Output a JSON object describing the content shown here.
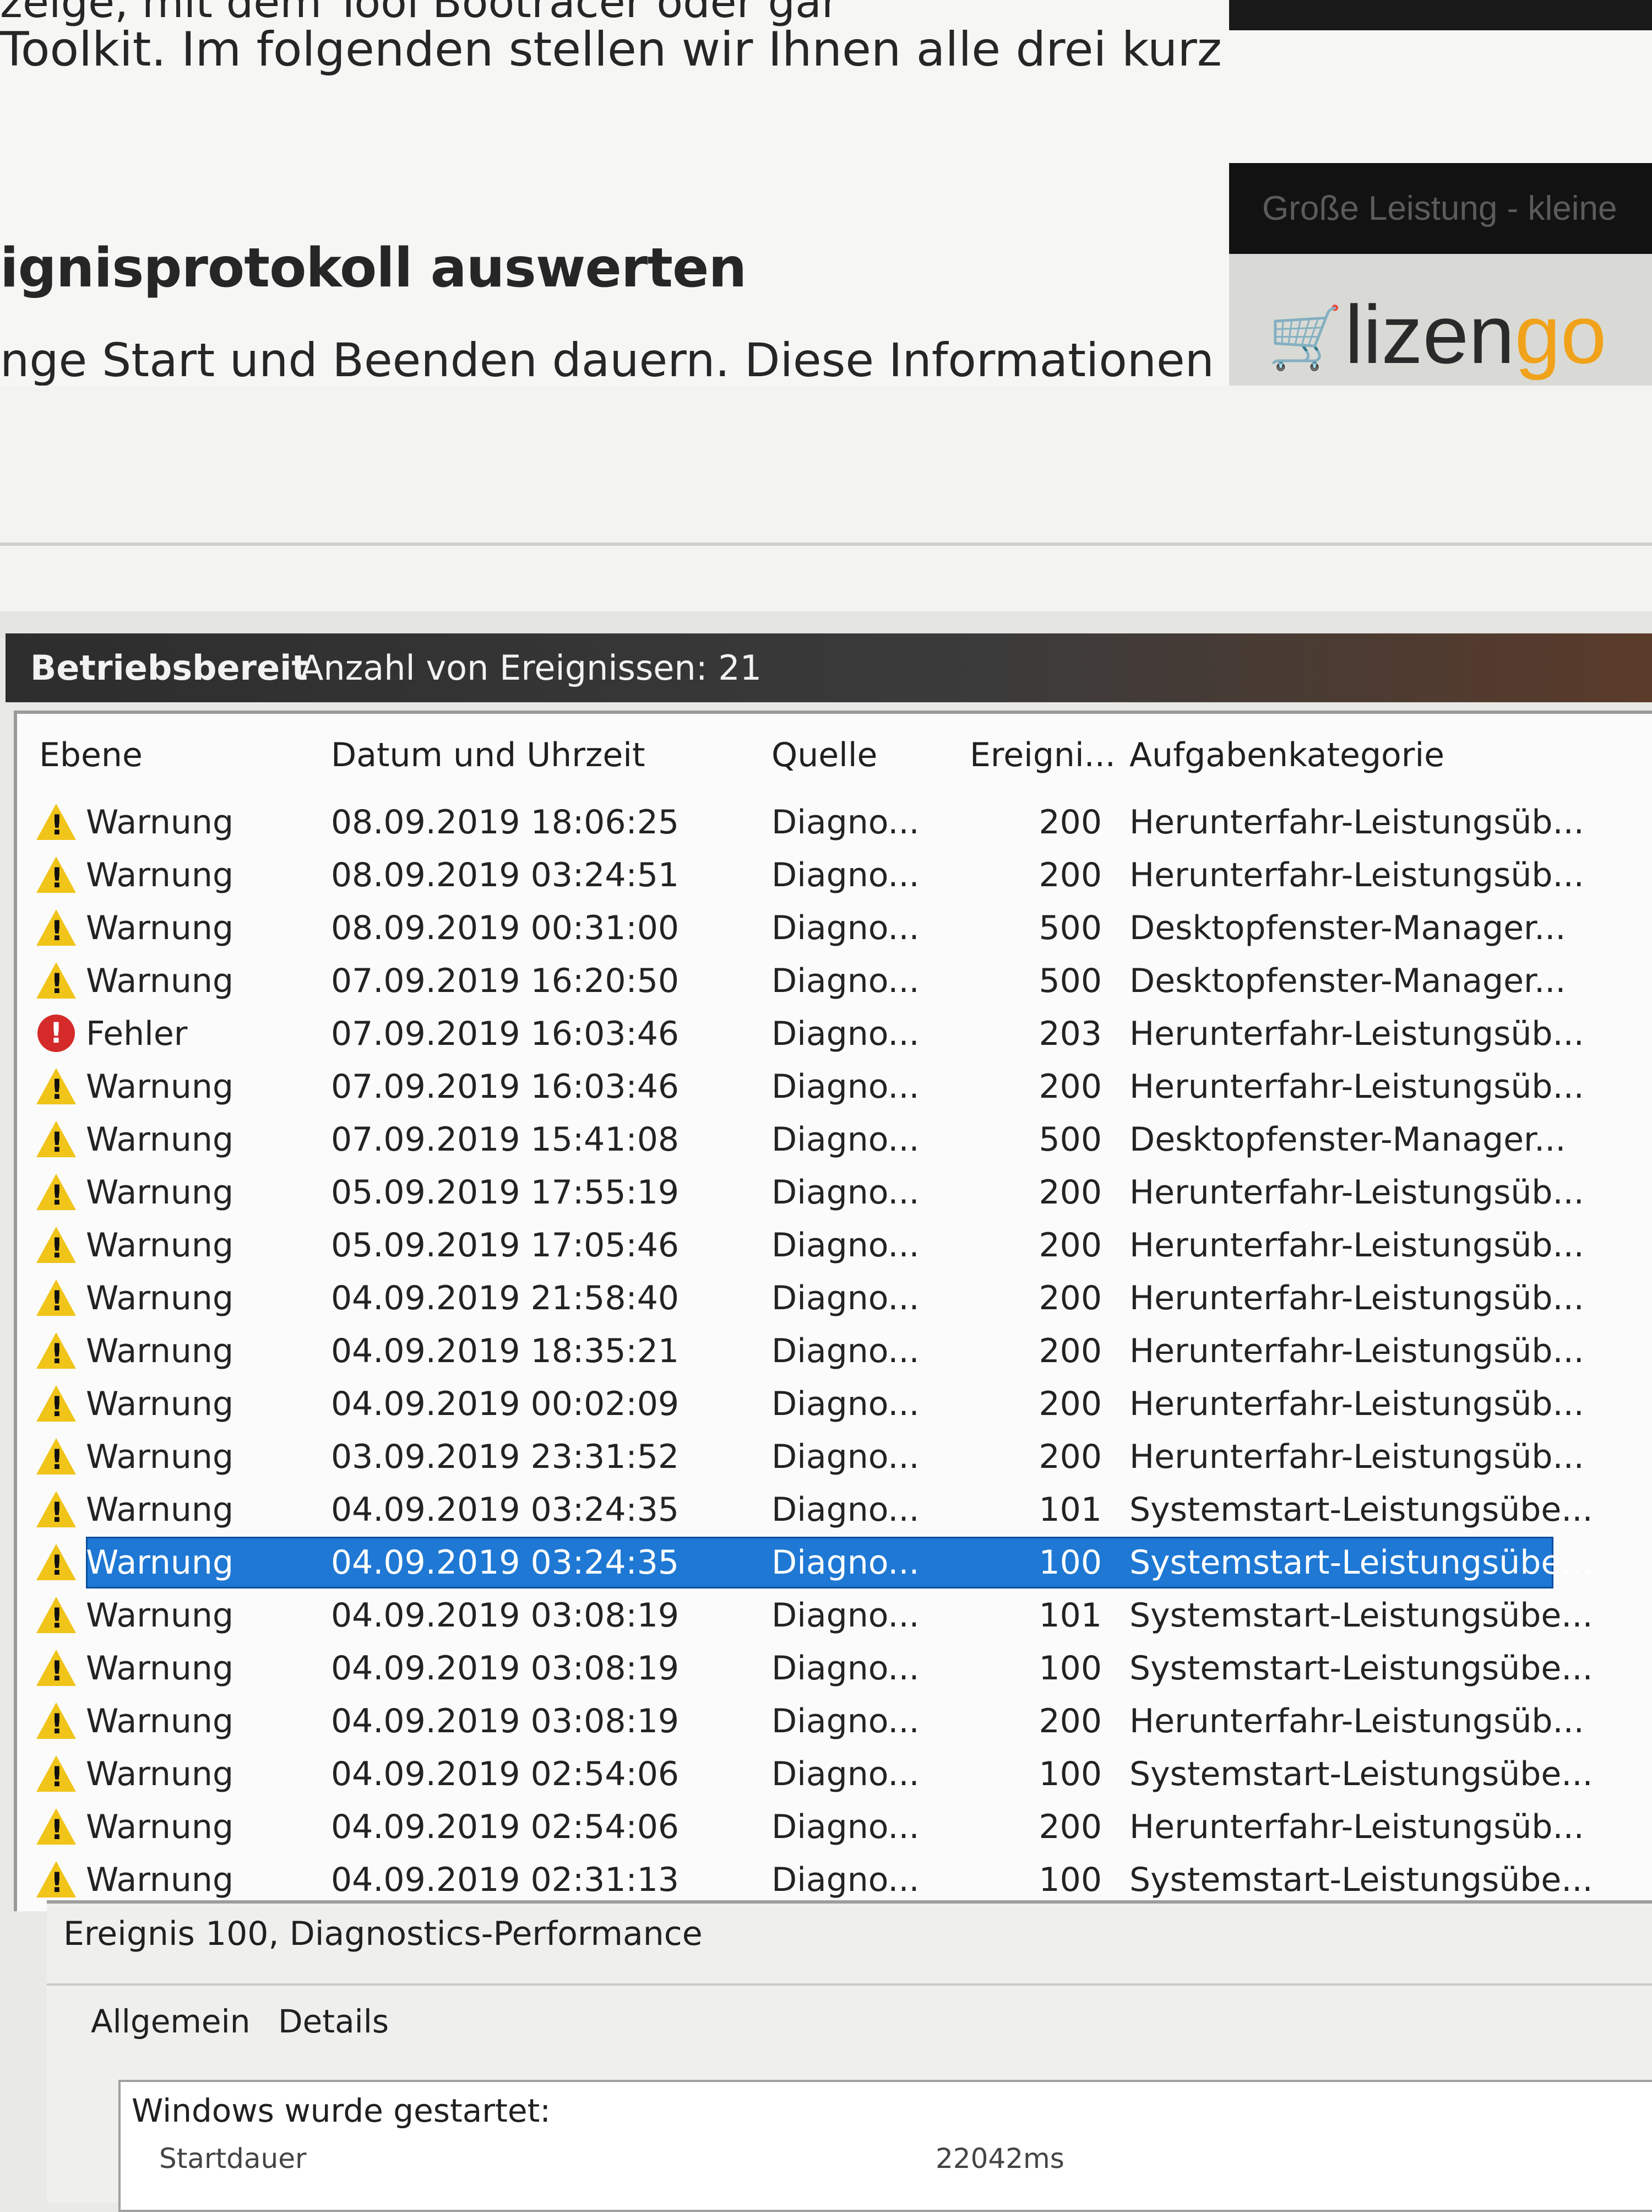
{
  "article": {
    "line0": "zeige, mit dem Tool Bootracer oder gar",
    "line1": "Toolkit. Im folgenden stellen wir Ihnen alle drei kurz",
    "heading": "ignisprotokoll auswerten",
    "line2": "nge Start und Beenden dauern. Diese Informationen"
  },
  "ad": {
    "banner_text": "Große Leistung - kleine",
    "logo_main": "lizen",
    "logo_accent": "go",
    "logo_icon": "cart-icon",
    "accent_color": "#f0a21a"
  },
  "panel": {
    "title": "Betriebsbereit",
    "count_label": "Anzahl von Ereignissen: 21"
  },
  "columns": {
    "level": "Ebene",
    "date": "Datum und Uhrzeit",
    "source": "Quelle",
    "event_id": "Ereigni...",
    "category": "Aufgabenkategorie"
  },
  "events": [
    {
      "level": "Warnung",
      "date": "08.09.2019 18:06:25",
      "source": "Diagno...",
      "id": "200",
      "category": "Herunterfahr-Leistungsüb...",
      "icon": "warning-icon"
    },
    {
      "level": "Warnung",
      "date": "08.09.2019 03:24:51",
      "source": "Diagno...",
      "id": "200",
      "category": "Herunterfahr-Leistungsüb...",
      "icon": "warning-icon"
    },
    {
      "level": "Warnung",
      "date": "08.09.2019 00:31:00",
      "source": "Diagno...",
      "id": "500",
      "category": "Desktopfenster-Manager...",
      "icon": "warning-icon"
    },
    {
      "level": "Warnung",
      "date": "07.09.2019 16:20:50",
      "source": "Diagno...",
      "id": "500",
      "category": "Desktopfenster-Manager...",
      "icon": "warning-icon"
    },
    {
      "level": "Fehler",
      "date": "07.09.2019 16:03:46",
      "source": "Diagno...",
      "id": "203",
      "category": "Herunterfahr-Leistungsüb...",
      "icon": "error-icon"
    },
    {
      "level": "Warnung",
      "date": "07.09.2019 16:03:46",
      "source": "Diagno...",
      "id": "200",
      "category": "Herunterfahr-Leistungsüb...",
      "icon": "warning-icon"
    },
    {
      "level": "Warnung",
      "date": "07.09.2019 15:41:08",
      "source": "Diagno...",
      "id": "500",
      "category": "Desktopfenster-Manager...",
      "icon": "warning-icon"
    },
    {
      "level": "Warnung",
      "date": "05.09.2019 17:55:19",
      "source": "Diagno...",
      "id": "200",
      "category": "Herunterfahr-Leistungsüb...",
      "icon": "warning-icon"
    },
    {
      "level": "Warnung",
      "date": "05.09.2019 17:05:46",
      "source": "Diagno...",
      "id": "200",
      "category": "Herunterfahr-Leistungsüb...",
      "icon": "warning-icon"
    },
    {
      "level": "Warnung",
      "date": "04.09.2019 21:58:40",
      "source": "Diagno...",
      "id": "200",
      "category": "Herunterfahr-Leistungsüb...",
      "icon": "warning-icon"
    },
    {
      "level": "Warnung",
      "date": "04.09.2019 18:35:21",
      "source": "Diagno...",
      "id": "200",
      "category": "Herunterfahr-Leistungsüb...",
      "icon": "warning-icon"
    },
    {
      "level": "Warnung",
      "date": "04.09.2019 00:02:09",
      "source": "Diagno...",
      "id": "200",
      "category": "Herunterfahr-Leistungsüb...",
      "icon": "warning-icon"
    },
    {
      "level": "Warnung",
      "date": "03.09.2019 23:31:52",
      "source": "Diagno...",
      "id": "200",
      "category": "Herunterfahr-Leistungsüb...",
      "icon": "warning-icon"
    },
    {
      "level": "Warnung",
      "date": "04.09.2019 03:24:35",
      "source": "Diagno...",
      "id": "101",
      "category": "Systemstart-Leistungsübe...",
      "icon": "warning-icon"
    },
    {
      "level": "Warnung",
      "date": "04.09.2019 03:24:35",
      "source": "Diagno...",
      "id": "100",
      "category": "Systemstart-Leistungsübe...",
      "icon": "warning-icon",
      "selected": true
    },
    {
      "level": "Warnung",
      "date": "04.09.2019 03:08:19",
      "source": "Diagno...",
      "id": "101",
      "category": "Systemstart-Leistungsübe...",
      "icon": "warning-icon"
    },
    {
      "level": "Warnung",
      "date": "04.09.2019 03:08:19",
      "source": "Diagno...",
      "id": "100",
      "category": "Systemstart-Leistungsübe...",
      "icon": "warning-icon"
    },
    {
      "level": "Warnung",
      "date": "04.09.2019 03:08:19",
      "source": "Diagno...",
      "id": "200",
      "category": "Herunterfahr-Leistungsüb...",
      "icon": "warning-icon"
    },
    {
      "level": "Warnung",
      "date": "04.09.2019 02:54:06",
      "source": "Diagno...",
      "id": "100",
      "category": "Systemstart-Leistungsübe...",
      "icon": "warning-icon"
    },
    {
      "level": "Warnung",
      "date": "04.09.2019 02:54:06",
      "source": "Diagno...",
      "id": "200",
      "category": "Herunterfahr-Leistungsüb...",
      "icon": "warning-icon"
    },
    {
      "level": "Warnung",
      "date": "04.09.2019 02:31:13",
      "source": "Diagno...",
      "id": "100",
      "category": "Systemstart-Leistungsübe...",
      "icon": "warning-icon"
    }
  ],
  "details": {
    "title": "Ereignis 100, Diagnostics-Performance",
    "tab_general": "Allgemein",
    "tab_details": "Details",
    "desc_line1": "Windows wurde gestartet:",
    "desc_line2": "Startdauer",
    "desc_value": "22042ms"
  },
  "colors": {
    "selection": "#1e78d4",
    "warning": "#f0c419",
    "error": "#d42a2a"
  }
}
